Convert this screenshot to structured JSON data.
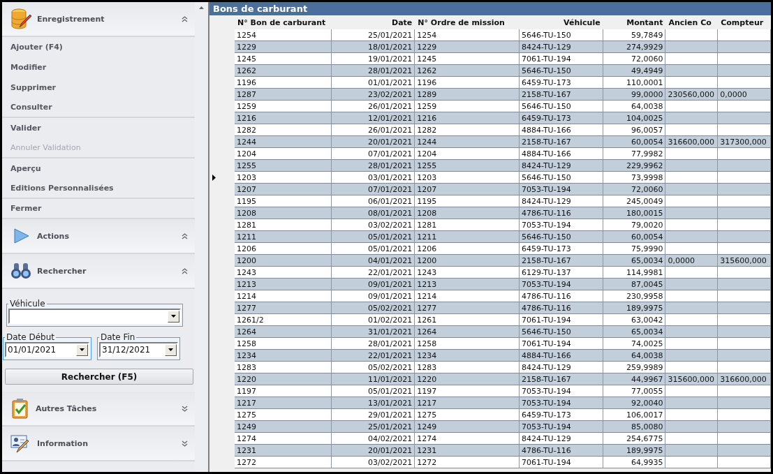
{
  "sidebar": {
    "sections": [
      {
        "kind": "menu",
        "title": "Enregistrement",
        "expanded": true,
        "items": [
          {
            "label": "Ajouter (F4)",
            "disabled": false,
            "divider": false
          },
          {
            "label": "Modifier",
            "disabled": false,
            "divider": false
          },
          {
            "label": "Supprimer",
            "disabled": false,
            "divider": false
          },
          {
            "label": "Consulter",
            "disabled": false,
            "divider": true
          },
          {
            "label": "Valider",
            "disabled": false,
            "divider": false
          },
          {
            "label": "Annuler Validation",
            "disabled": true,
            "divider": true
          },
          {
            "label": "Aperçu",
            "disabled": false,
            "divider": false
          },
          {
            "label": "Editions Personnalisées",
            "disabled": false,
            "divider": true
          },
          {
            "label": "Fermer",
            "disabled": false,
            "divider": true
          }
        ]
      },
      {
        "kind": "header",
        "title": "Actions",
        "expanded": true
      },
      {
        "kind": "search",
        "title": "Rechercher",
        "expanded": true,
        "vehicle": {
          "label": "Véhicule"
        },
        "date_start": {
          "label": "Date Début",
          "value": "01/01/2021"
        },
        "date_end": {
          "label": "Date Fin",
          "value": "31/12/2021"
        },
        "button": "Rechercher (F5)"
      },
      {
        "kind": "header",
        "title": "Autres Tâches",
        "expanded": false
      },
      {
        "kind": "header",
        "title": "Information",
        "expanded": false
      }
    ]
  },
  "grid": {
    "title": "Bons de carburant",
    "columns": [
      "N° Bon de carburant",
      "Date",
      "N° Ordre de mission",
      "Véhicule",
      "Montant",
      "Ancien Co",
      "Compteur"
    ],
    "rows": [
      {
        "current": false,
        "cells": [
          "1254",
          "25/01/2021",
          "1254",
          "5646-TU-150",
          "59,7849",
          "",
          ""
        ]
      },
      {
        "current": false,
        "cells": [
          "1229",
          "18/01/2021",
          "1229",
          "8424-TU-129",
          "274,9929",
          "",
          ""
        ]
      },
      {
        "current": false,
        "cells": [
          "1245",
          "19/01/2021",
          "1245",
          "7061-TU-194",
          "72,0060",
          "",
          ""
        ]
      },
      {
        "current": false,
        "cells": [
          "1262",
          "28/01/2021",
          "1262",
          "5646-TU-150",
          "49,4949",
          "",
          ""
        ]
      },
      {
        "current": false,
        "cells": [
          "1196",
          "01/01/2021",
          "1196",
          "6459-TU-173",
          "110,0001",
          "",
          ""
        ]
      },
      {
        "current": false,
        "cells": [
          "1287",
          "23/02/2021",
          "1289",
          "2158-TU-167",
          "99,0000",
          "230560,000",
          "0,0000"
        ]
      },
      {
        "current": false,
        "cells": [
          "1259",
          "26/01/2021",
          "1259",
          "5646-TU-150",
          "64,0038",
          "",
          ""
        ]
      },
      {
        "current": false,
        "cells": [
          "1216",
          "12/01/2021",
          "1216",
          "6459-TU-173",
          "104,0025",
          "",
          ""
        ]
      },
      {
        "current": false,
        "cells": [
          "1282",
          "26/01/2021",
          "1282",
          "4884-TU-166",
          "96,0057",
          "",
          ""
        ]
      },
      {
        "current": false,
        "cells": [
          "1244",
          "20/01/2021",
          "1244",
          "2158-TU-167",
          "60,0054",
          "316600,000",
          "317300,000"
        ]
      },
      {
        "current": false,
        "cells": [
          "1204",
          "07/01/2021",
          "1204",
          "4884-TU-166",
          "77,9982",
          "",
          ""
        ]
      },
      {
        "current": false,
        "cells": [
          "1255",
          "28/01/2021",
          "1255",
          "8424-TU-129",
          "229,9962",
          "",
          ""
        ]
      },
      {
        "current": true,
        "cells": [
          "1203",
          "03/01/2021",
          "1203",
          "5646-TU-150",
          "73,9998",
          "",
          ""
        ]
      },
      {
        "current": false,
        "cells": [
          "1207",
          "07/01/2021",
          "1207",
          "7053-TU-194",
          "72,0060",
          "",
          ""
        ]
      },
      {
        "current": false,
        "cells": [
          "1195",
          "06/01/2021",
          "1195",
          "8424-TU-129",
          "245,0049",
          "",
          ""
        ]
      },
      {
        "current": false,
        "cells": [
          "1208",
          "08/01/2021",
          "1208",
          "4786-TU-116",
          "180,0015",
          "",
          ""
        ]
      },
      {
        "current": false,
        "cells": [
          "1281",
          "03/02/2021",
          "1281",
          "7053-TU-194",
          "79,0020",
          "",
          ""
        ]
      },
      {
        "current": false,
        "cells": [
          "1211",
          "05/01/2021",
          "1211",
          "5646-TU-150",
          "60,0054",
          "",
          ""
        ]
      },
      {
        "current": false,
        "cells": [
          "1206",
          "05/01/2021",
          "1206",
          "6459-TU-173",
          "75,9990",
          "",
          ""
        ]
      },
      {
        "current": false,
        "cells": [
          "1200",
          "04/01/2021",
          "1200",
          "2158-TU-167",
          "65,0034",
          "0,0000",
          "315600,000"
        ]
      },
      {
        "current": false,
        "cells": [
          "1243",
          "22/01/2021",
          "1243",
          "6129-TU-137",
          "114,9981",
          "",
          ""
        ]
      },
      {
        "current": false,
        "cells": [
          "1213",
          "09/01/2021",
          "1213",
          "7053-TU-194",
          "87,0045",
          "",
          ""
        ]
      },
      {
        "current": false,
        "cells": [
          "1214",
          "09/01/2021",
          "1214",
          "4786-TU-116",
          "230,9958",
          "",
          ""
        ]
      },
      {
        "current": false,
        "cells": [
          "1277",
          "05/02/2021",
          "1277",
          "4786-TU-116",
          "189,9975",
          "",
          ""
        ]
      },
      {
        "current": false,
        "cells": [
          "1261/2",
          "01/02/2021",
          "1261",
          "7061-TU-194",
          "63,0042",
          "",
          ""
        ]
      },
      {
        "current": false,
        "cells": [
          "1264",
          "31/01/2021",
          "1264",
          "5646-TU-150",
          "65,0034",
          "",
          ""
        ]
      },
      {
        "current": false,
        "cells": [
          "1258",
          "28/01/2021",
          "1258",
          "7061-TU-194",
          "74,0025",
          "",
          ""
        ]
      },
      {
        "current": false,
        "cells": [
          "1234",
          "22/01/2021",
          "1234",
          "4884-TU-166",
          "64,0038",
          "",
          ""
        ]
      },
      {
        "current": false,
        "cells": [
          "1283",
          "05/02/2021",
          "1283",
          "8424-TU-129",
          "259,9989",
          "",
          ""
        ]
      },
      {
        "current": false,
        "cells": [
          "1220",
          "11/01/2021",
          "1220",
          "2158-TU-167",
          "44,9967",
          "315600,000",
          "316600,000"
        ]
      },
      {
        "current": false,
        "cells": [
          "1197",
          "05/01/2021",
          "1197",
          "7053-TU-194",
          "77,0055",
          "",
          ""
        ]
      },
      {
        "current": false,
        "cells": [
          "1217",
          "13/01/2021",
          "1217",
          "7053-TU-194",
          "92,0040",
          "",
          ""
        ]
      },
      {
        "current": false,
        "cells": [
          "1275",
          "29/01/2021",
          "1275",
          "6459-TU-173",
          "106,0017",
          "",
          ""
        ]
      },
      {
        "current": false,
        "cells": [
          "1249",
          "25/01/2021",
          "1249",
          "7053-TU-194",
          "85,0080",
          "",
          ""
        ]
      },
      {
        "current": false,
        "cells": [
          "1274",
          "04/02/2021",
          "1274",
          "8424-TU-129",
          "254,6775",
          "",
          ""
        ]
      },
      {
        "current": false,
        "cells": [
          "1231",
          "20/01/2021",
          "1231",
          "4786-TU-116",
          "189,9975",
          "",
          ""
        ]
      },
      {
        "current": false,
        "cells": [
          "1272",
          "03/02/2021",
          "1272",
          "7061-TU-194",
          "64,9935",
          "",
          ""
        ]
      }
    ]
  }
}
